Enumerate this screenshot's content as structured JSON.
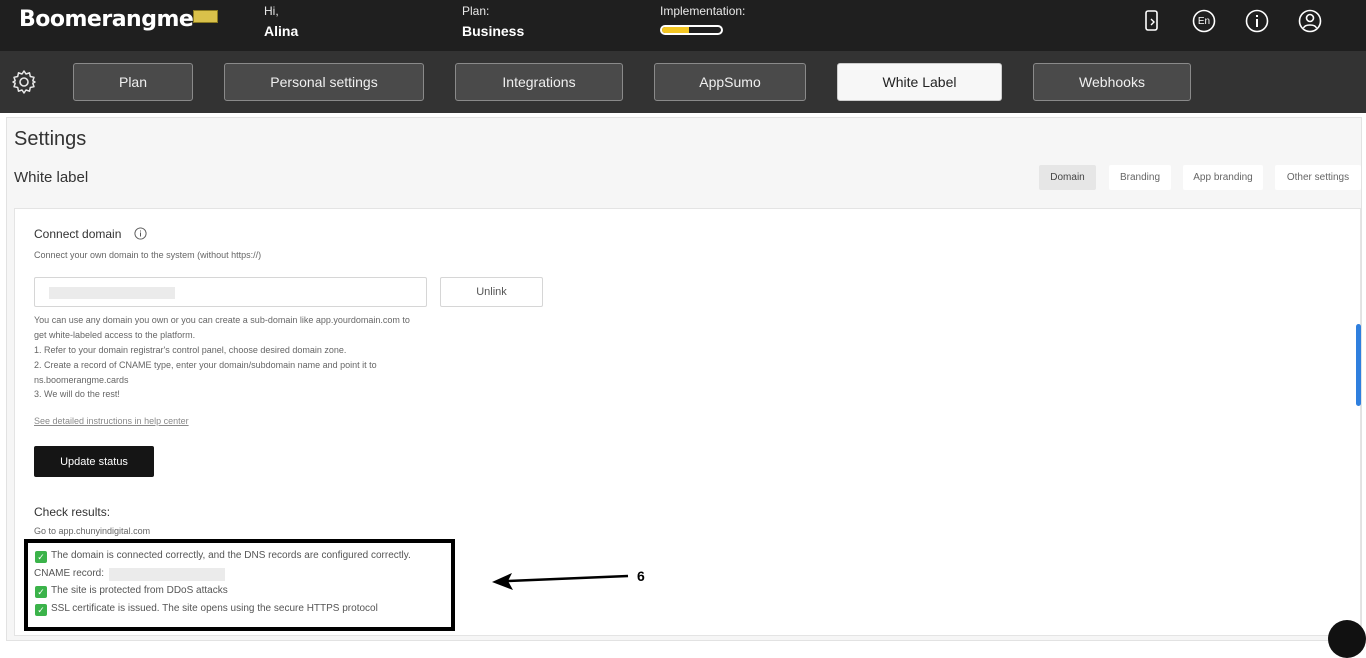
{
  "header": {
    "logo": "Boomerangme",
    "greeting_label": "Hi,",
    "user_name": "Alina",
    "plan_label": "Plan:",
    "plan_value": "Business",
    "implementation_label": "Implementation:",
    "implementation_progress": 0.45,
    "language": "En"
  },
  "nav": {
    "tabs": [
      {
        "label": "Plan"
      },
      {
        "label": "Personal settings"
      },
      {
        "label": "Integrations"
      },
      {
        "label": "AppSumo"
      },
      {
        "label": "White Label"
      },
      {
        "label": "Webhooks"
      }
    ],
    "active": "White Label"
  },
  "page": {
    "title": "Settings",
    "section": "White label",
    "subtabs": [
      {
        "label": "Domain"
      },
      {
        "label": "Branding"
      },
      {
        "label": "App branding"
      },
      {
        "label": "Other settings"
      }
    ],
    "active_subtab": "Domain"
  },
  "domain": {
    "heading": "Connect domain",
    "subheading": "Connect your own domain to the system (without https://)",
    "unlink_label": "Unlink",
    "help_lines": [
      "You can use any domain you own or you can create a sub-domain like app.yourdomain.com to",
      "get white-labeled access to the platform.",
      "1. Refer to your domain registrar's control panel, choose desired domain zone.",
      "2. Create a record of CNAME type, enter your domain/subdomain name and point it to",
      "ns.boomerangme.cards",
      "3. We will do the rest!"
    ],
    "help_link": "See detailed instructions in help center",
    "update_button": "Update status",
    "results_heading": "Check results:",
    "goto_text": "Go to app.chunyindigital.com",
    "results": {
      "dns": "The domain is connected correctly, and the DNS records are configured correctly.",
      "cname_label": "CNAME record:",
      "ddos": "The site is protected from DDoS attacks",
      "ssl": "SSL certificate is issued. The site opens using the secure HTTPS protocol"
    }
  },
  "annotation": {
    "number": "6"
  },
  "colors": {
    "topbar": "#1f1f1f",
    "navbar": "#333333",
    "progress": "#f3c623",
    "check": "#3bb34a",
    "scroll": "#2f7fde"
  }
}
